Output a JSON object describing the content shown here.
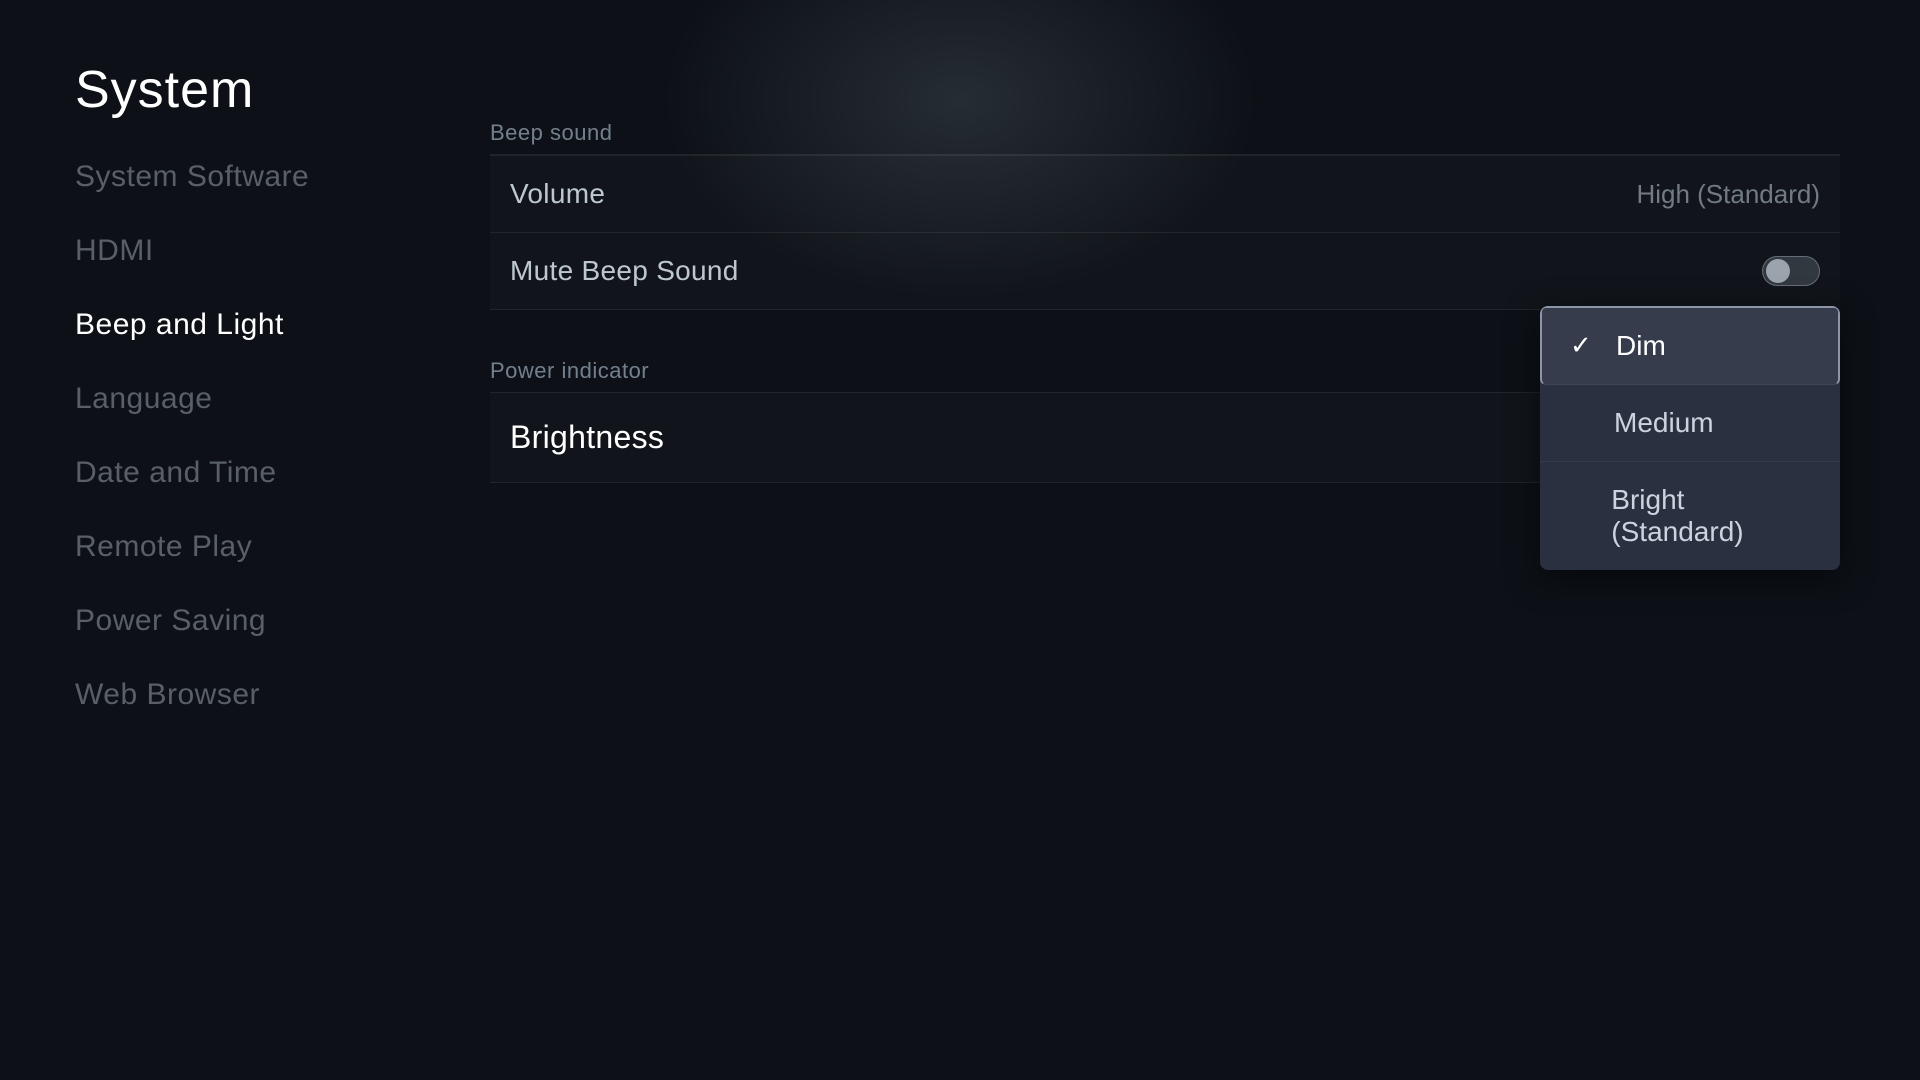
{
  "page": {
    "title": "System"
  },
  "sidebar": {
    "items": [
      {
        "id": "system-software",
        "label": "System Software",
        "active": false
      },
      {
        "id": "hdmi",
        "label": "HDMI",
        "active": false
      },
      {
        "id": "beep-and-light",
        "label": "Beep and Light",
        "active": true
      },
      {
        "id": "language",
        "label": "Language",
        "active": false
      },
      {
        "id": "date-and-time",
        "label": "Date and Time",
        "active": false
      },
      {
        "id": "remote-play",
        "label": "Remote Play",
        "active": false
      },
      {
        "id": "power-saving",
        "label": "Power Saving",
        "active": false
      },
      {
        "id": "web-browser",
        "label": "Web Browser",
        "active": false
      }
    ]
  },
  "beep_sound": {
    "section_label": "Beep sound",
    "volume": {
      "label": "Volume",
      "value": "High (Standard)"
    },
    "mute": {
      "label": "Mute Beep Sound",
      "enabled": false
    }
  },
  "power_indicator": {
    "section_label": "Power indicator",
    "brightness": {
      "label": "Brightness",
      "options": [
        {
          "id": "dim",
          "label": "Dim",
          "selected": true
        },
        {
          "id": "medium",
          "label": "Medium",
          "selected": false
        },
        {
          "id": "bright",
          "label": "Bright (Standard)",
          "selected": false
        }
      ]
    }
  },
  "icons": {
    "checkmark": "✓"
  }
}
